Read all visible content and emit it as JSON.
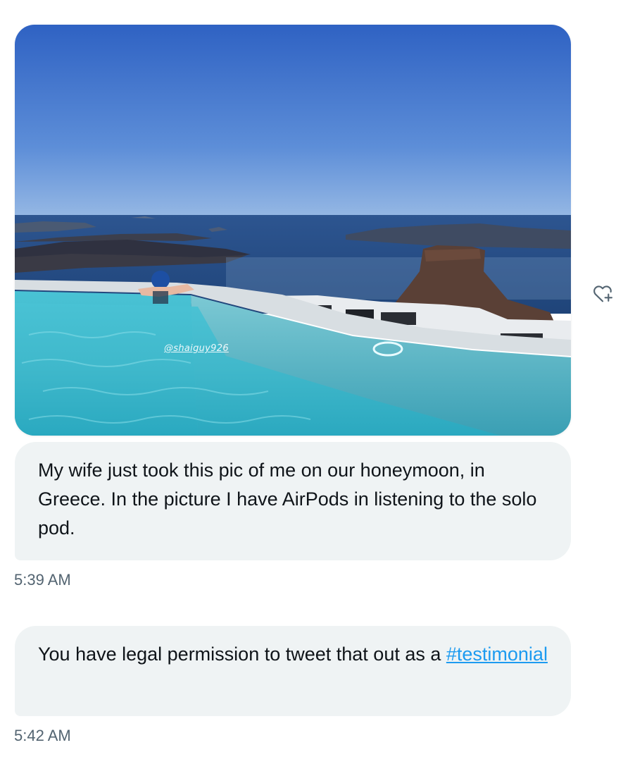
{
  "media": {
    "watermark": "@shaiguy926"
  },
  "messages": [
    {
      "text": "My wife just took this pic of me on our honeymoon, in Greece. In the picture I have AirPods in listening to the solo pod.",
      "time": "5:39 AM"
    },
    {
      "text_before": "You have legal permission to tweet that out as a ",
      "hashtag": "#testimonial",
      "time": "5:42 AM"
    }
  ],
  "icons": {
    "reaction": "heart-plus-icon"
  },
  "colors": {
    "bubble_bg": "#eff3f4",
    "link": "#1d9bf0",
    "timestamp": "#536471",
    "icon": "#536471"
  }
}
